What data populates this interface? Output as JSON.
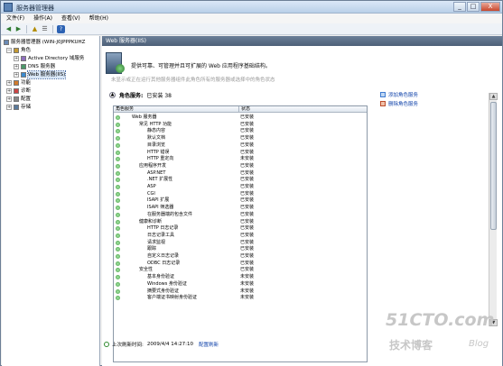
{
  "window": {
    "title": "服务器管理器",
    "buttons": [
      "_",
      "□",
      "X"
    ]
  },
  "menu": [
    "文件(F)",
    "操作(A)",
    "查看(V)",
    "帮助(H)"
  ],
  "toolbar": {
    "icons": [
      "back-arrow-icon",
      "forward-arrow-icon",
      "up-folder-icon",
      "list-view-icon",
      "help-icon"
    ],
    "help_label": "?"
  },
  "tree": {
    "root": "服务器管理器 (WIN-J0JPPPKUHZ",
    "roles": "角色",
    "ad": "Active Directory 域服务",
    "dns": "DNS 服务器",
    "web": "Web 服务器(IIS)",
    "features": "功能",
    "diagnostics": "诊断",
    "config": "配置",
    "storage": "存储"
  },
  "main": {
    "header": "Web 服务器(IIS)",
    "banner": "提供可靠、可管理并且可扩展的 Web 应用程序基础结构。",
    "banner_faded": "未显示或正在运行其他服务器组件此角色所有的服务器或选择中的角色状态",
    "summary": {
      "title": "角色服务:",
      "count": "已安装 38"
    },
    "table": {
      "col_role": "角色服务",
      "col_status": "状态"
    },
    "actions": {
      "add": "添加角色服务",
      "remove": "删除角色服务"
    },
    "status_line": {
      "label": "上次刷新时间:",
      "time": "2009/4/4 14:27:10",
      "link": "配置刷新"
    }
  },
  "role_services": [
    {
      "name": "Web 服务器",
      "status": "已安装",
      "indent": 0
    },
    {
      "name": "常见 HTTP 功能",
      "status": "已安装",
      "indent": 1
    },
    {
      "name": "静态内容",
      "status": "已安装",
      "indent": 2
    },
    {
      "name": "默认文档",
      "status": "已安装",
      "indent": 2
    },
    {
      "name": "目录浏览",
      "status": "已安装",
      "indent": 2
    },
    {
      "name": "HTTP 错误",
      "status": "已安装",
      "indent": 2
    },
    {
      "name": "HTTP 重定向",
      "status": "未安装",
      "indent": 2
    },
    {
      "name": "应用程序开发",
      "status": "已安装",
      "indent": 1
    },
    {
      "name": "ASP.NET",
      "status": "已安装",
      "indent": 2
    },
    {
      "name": ".NET 扩展性",
      "status": "已安装",
      "indent": 2
    },
    {
      "name": "ASP",
      "status": "已安装",
      "indent": 2
    },
    {
      "name": "CGI",
      "status": "已安装",
      "indent": 2
    },
    {
      "name": "ISAPI 扩展",
      "status": "已安装",
      "indent": 2
    },
    {
      "name": "ISAPI 筛选器",
      "status": "已安装",
      "indent": 2
    },
    {
      "name": "在服务器端的包含文件",
      "status": "已安装",
      "indent": 2
    },
    {
      "name": "健康和诊断",
      "status": "已安装",
      "indent": 1
    },
    {
      "name": "HTTP 日志记录",
      "status": "已安装",
      "indent": 2
    },
    {
      "name": "日志记录工具",
      "status": "已安装",
      "indent": 2
    },
    {
      "name": "请求监视",
      "status": "已安装",
      "indent": 2
    },
    {
      "name": "跟踪",
      "status": "已安装",
      "indent": 2
    },
    {
      "name": "自定义日志记录",
      "status": "已安装",
      "indent": 2
    },
    {
      "name": "ODBC 日志记录",
      "status": "已安装",
      "indent": 2
    },
    {
      "name": "安全性",
      "status": "已安装",
      "indent": 1
    },
    {
      "name": "基本身份验证",
      "status": "未安装",
      "indent": 2
    },
    {
      "name": "Windows 身份验证",
      "status": "未安装",
      "indent": 2
    },
    {
      "name": "摘要式身份验证",
      "status": "未安装",
      "indent": 2
    },
    {
      "name": "客户端证书映射身份验证",
      "status": "未安装",
      "indent": 2
    }
  ],
  "watermark": {
    "domain": "51CTO.com",
    "sub": "技术博客",
    "blog": "Blog"
  }
}
